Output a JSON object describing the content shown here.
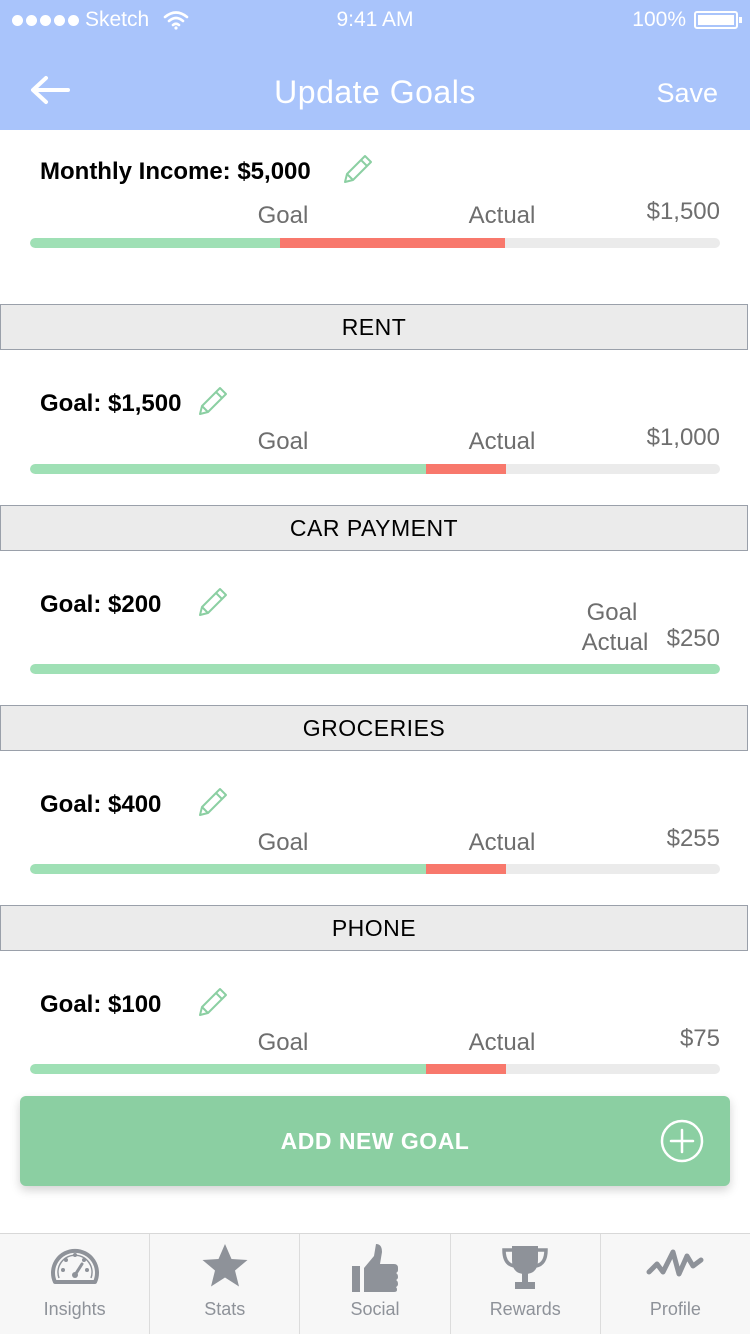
{
  "status_bar": {
    "carrier": "Sketch",
    "time": "9:41 AM",
    "battery": "100%"
  },
  "nav": {
    "title": "Update Goals",
    "save_label": "Save"
  },
  "income": {
    "label": "Monthly Income: $5,000",
    "goal_marker": "Goal",
    "actual_marker": "Actual",
    "amount": "$1,500"
  },
  "goals": [
    {
      "category": "RENT",
      "label": "Goal: $1,500",
      "goal_marker": "Goal",
      "actual_marker": "Actual",
      "amount": "$1,000"
    },
    {
      "category": "CAR PAYMENT",
      "label": "Goal: $200",
      "goal_marker": "Goal",
      "actual_marker": "Actual",
      "amount": "$250"
    },
    {
      "category": "GROCERIES",
      "label": "Goal: $400",
      "goal_marker": "Goal",
      "actual_marker": "Actual",
      "amount": "$255"
    },
    {
      "category": "PHONE",
      "label": "Goal: $100",
      "goal_marker": "Goal",
      "actual_marker": "Actual",
      "amount": "$75"
    }
  ],
  "add_goal": {
    "label": "ADD NEW GOAL"
  },
  "tabs": [
    {
      "label": "Insights",
      "icon": "gauge-icon"
    },
    {
      "label": "Stats",
      "icon": "star-icon"
    },
    {
      "label": "Social",
      "icon": "thumbs-up-icon"
    },
    {
      "label": "Rewards",
      "icon": "trophy-icon"
    },
    {
      "label": "Profile",
      "icon": "activity-icon"
    }
  ],
  "colors": {
    "header_bg": "#a9c4fb",
    "progress_goal": "#9fe0b5",
    "progress_over": "#f8786c",
    "progress_track": "#ebebeb",
    "add_button": "#8bcfa2",
    "tab_icon": "#8e9299"
  }
}
